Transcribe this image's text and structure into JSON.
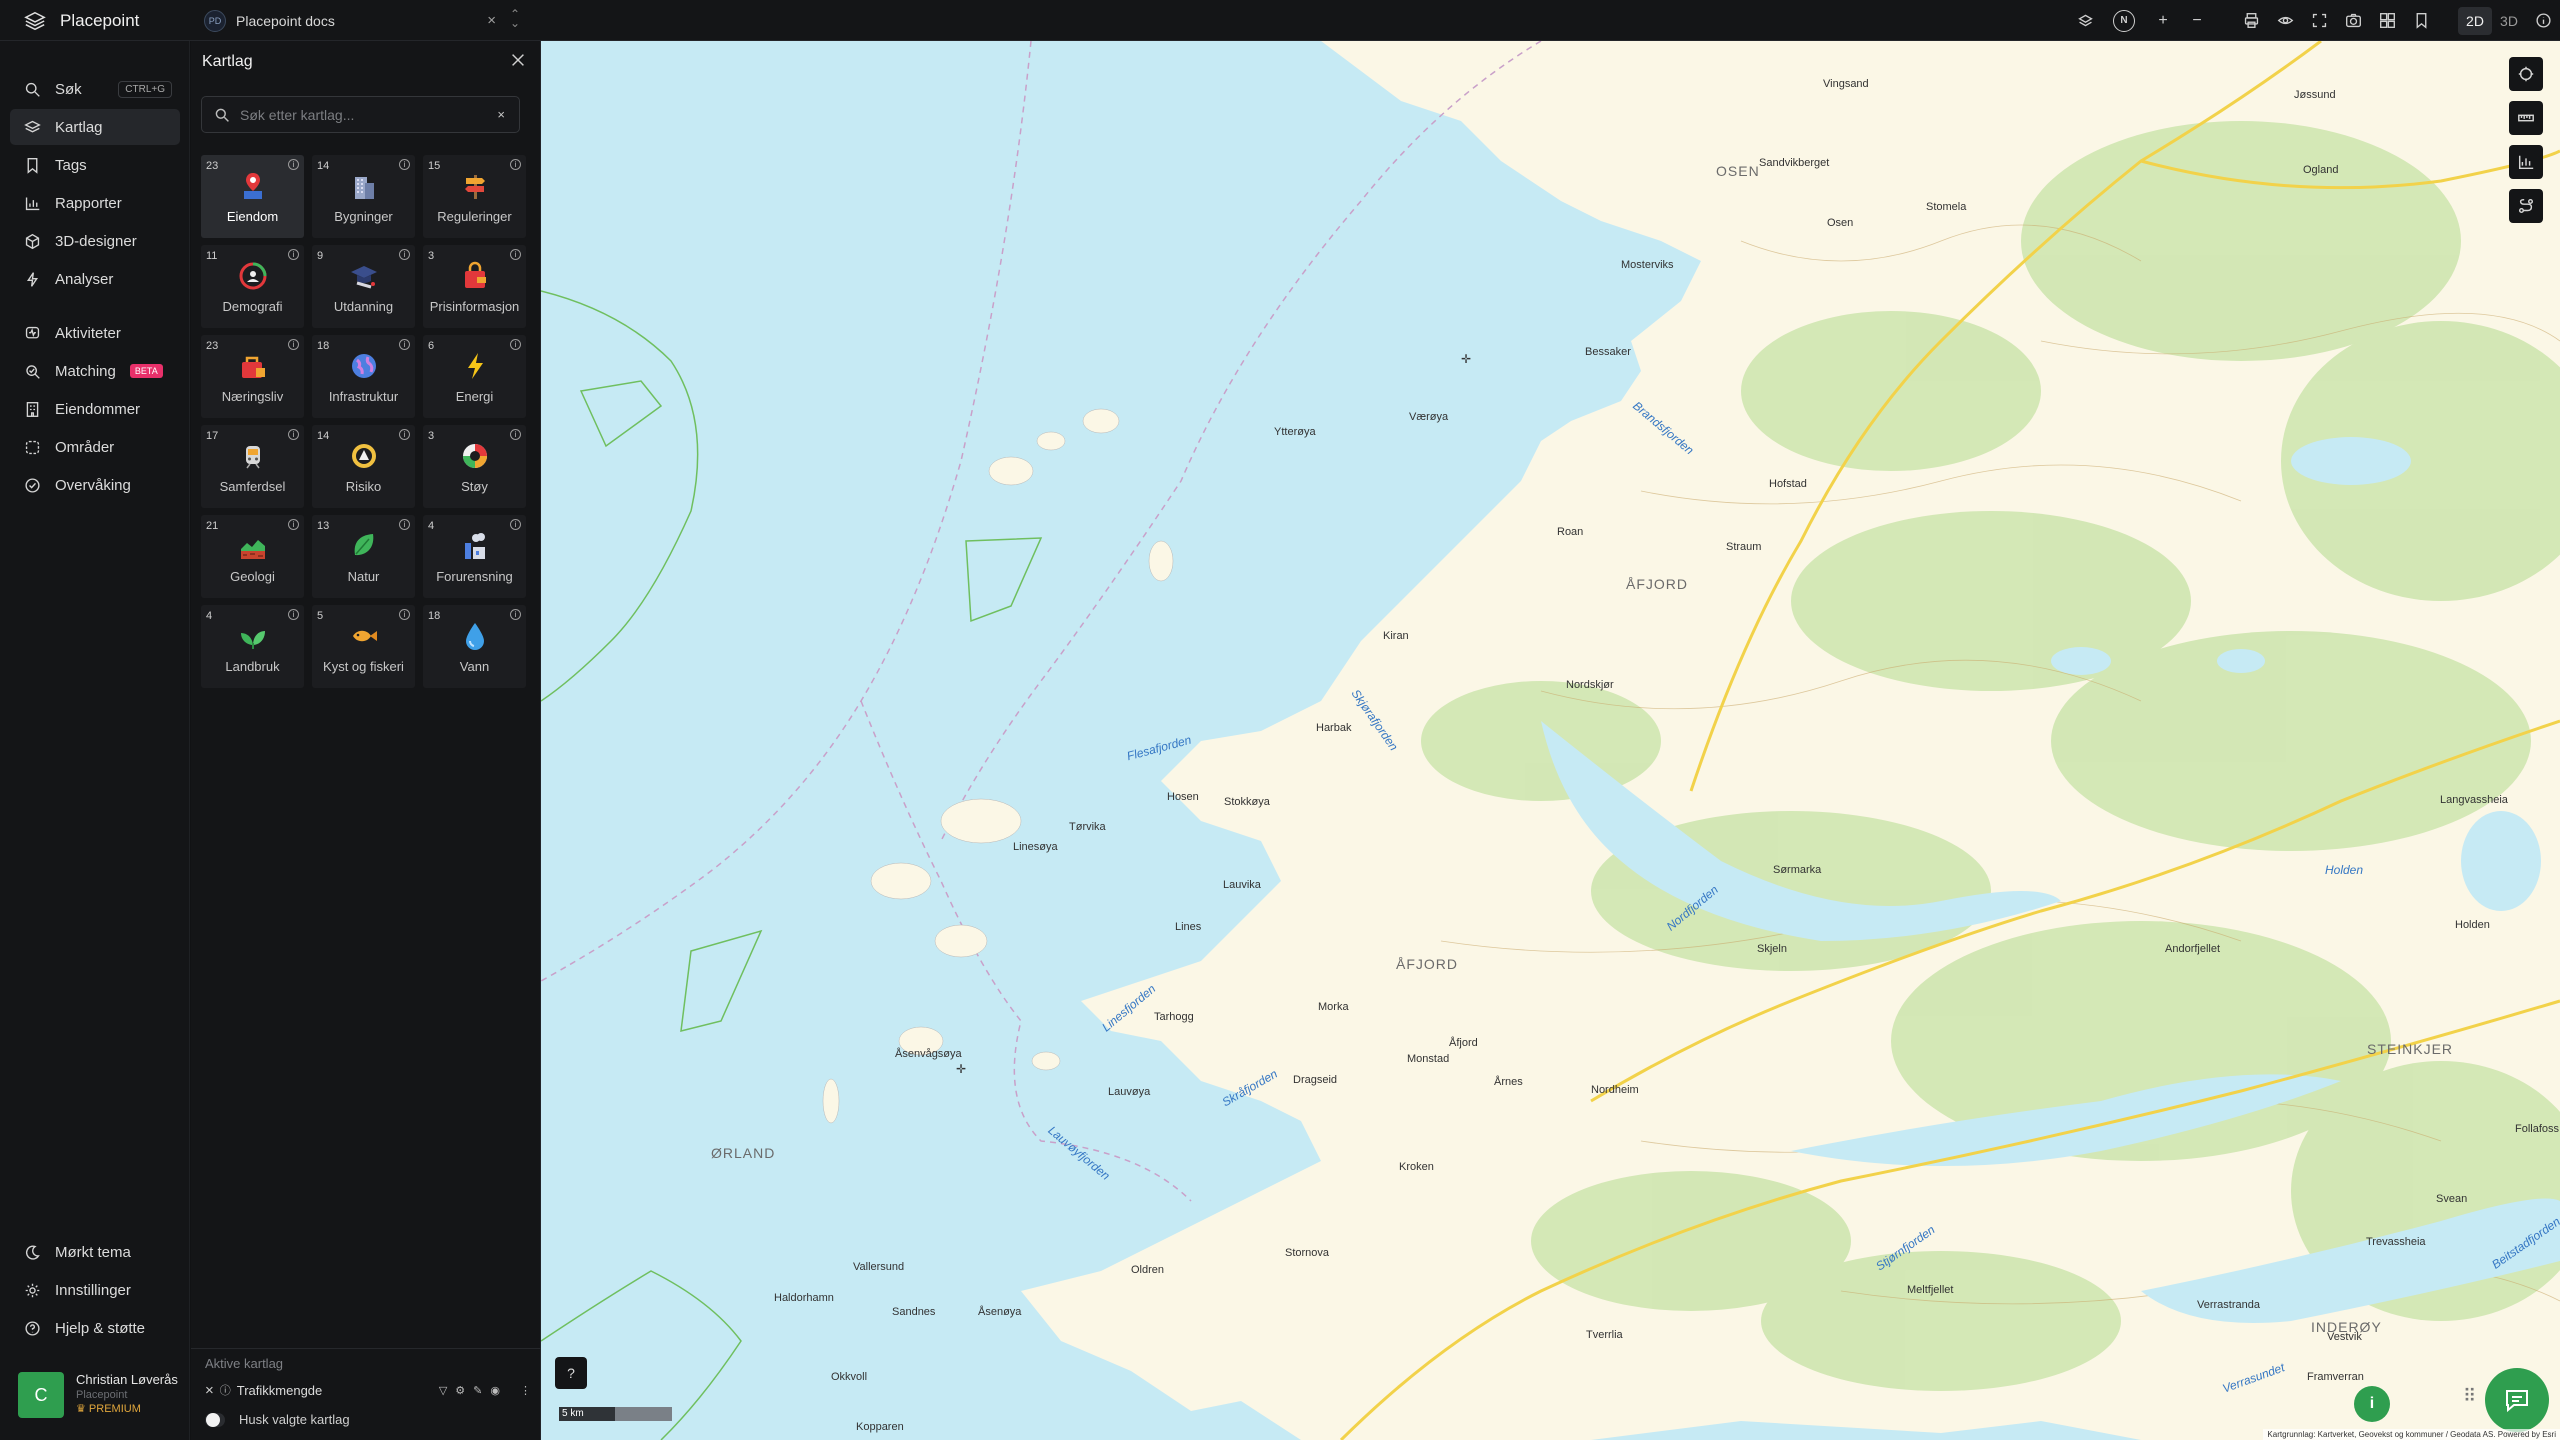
{
  "app": {
    "name": "Placepoint"
  },
  "docs_tab": {
    "badge": "PD",
    "title": "Placepoint docs",
    "close": "×",
    "switch": "⌃⌄"
  },
  "toolbar": {
    "icons": [
      "layers-download-icon",
      "compass-icon",
      "zoom-in-icon",
      "zoom-out-icon",
      "print-icon",
      "eye-icon",
      "fullscreen-icon",
      "camera-icon",
      "grid-icon",
      "bookmark-icon"
    ],
    "compass_label": "N",
    "zoom_in": "+",
    "zoom_out": "−",
    "mode_2d": "2D",
    "mode_3d": "3D",
    "active_mode": "2D"
  },
  "sidebar": {
    "items": [
      {
        "label": "Søk",
        "icon": "search-icon",
        "shortcut": "CTRL+G"
      },
      {
        "label": "Kartlag",
        "icon": "layers-icon",
        "active": true
      },
      {
        "label": "Tags",
        "icon": "bookmark-icon"
      },
      {
        "label": "Rapporter",
        "icon": "bar-chart-icon"
      },
      {
        "label": "3D-designer",
        "icon": "cube-icon"
      },
      {
        "label": "Analyser",
        "icon": "bolt-icon"
      },
      {
        "label": "Aktiviteter",
        "icon": "activity-icon"
      },
      {
        "label": "Matching",
        "icon": "match-icon",
        "badge": "BETA"
      },
      {
        "label": "Eiendommer",
        "icon": "building-icon"
      },
      {
        "label": "Områder",
        "icon": "area-icon"
      },
      {
        "label": "Overvåking",
        "icon": "monitor-icon"
      }
    ],
    "bottom": [
      {
        "label": "Mørkt tema",
        "icon": "moon-icon"
      },
      {
        "label": "Innstillinger",
        "icon": "gear-icon"
      },
      {
        "label": "Hjelp & støtte",
        "icon": "help-icon"
      }
    ],
    "user": {
      "initial": "C",
      "name": "Christian Løverås",
      "org": "Placepoint",
      "plan": "PREMIUM"
    }
  },
  "panel": {
    "title": "Kartlag",
    "search_placeholder": "Søk etter kartlag...",
    "search_clear": "×",
    "layers": [
      {
        "count": "23",
        "label": "Eiendom",
        "icon": "property-pin-icon",
        "selected": true
      },
      {
        "count": "14",
        "label": "Bygninger",
        "icon": "buildings-icon"
      },
      {
        "count": "15",
        "label": "Reguleringer",
        "icon": "signpost-icon"
      },
      {
        "count": "11",
        "label": "Demografi",
        "icon": "demography-gauge-icon"
      },
      {
        "count": "9",
        "label": "Utdanning",
        "icon": "graduation-cap-icon"
      },
      {
        "count": "3",
        "label": "Prisinformasjon",
        "icon": "price-bag-icon"
      },
      {
        "count": "23",
        "label": "Næringsliv",
        "icon": "business-bag-icon"
      },
      {
        "count": "18",
        "label": "Infrastruktur",
        "icon": "globe-icon"
      },
      {
        "count": "6",
        "label": "Energi",
        "icon": "lightning-icon"
      },
      {
        "count": "17",
        "label": "Samferdsel",
        "icon": "train-icon"
      },
      {
        "count": "14",
        "label": "Risiko",
        "icon": "hazard-icon"
      },
      {
        "count": "3",
        "label": "Støy",
        "icon": "noise-gauge-icon"
      },
      {
        "count": "21",
        "label": "Geologi",
        "icon": "geology-icon"
      },
      {
        "count": "13",
        "label": "Natur",
        "icon": "leaf-icon"
      },
      {
        "count": "4",
        "label": "Forurensning",
        "icon": "factory-icon"
      },
      {
        "count": "4",
        "label": "Landbruk",
        "icon": "sprout-icon"
      },
      {
        "count": "5",
        "label": "Kyst og fiskeri",
        "icon": "fish-icon"
      },
      {
        "count": "18",
        "label": "Vann",
        "icon": "water-drop-icon"
      }
    ],
    "active_title": "Aktive kartlag",
    "active_layer": "Trafikkmengde",
    "remember_label": "Husk valgte kartlag"
  },
  "map": {
    "labels_big": [
      "ØRLAND",
      "ÅFJORD",
      "ÅFJORD",
      "OSEN",
      "INDERØY",
      "STEINKJER"
    ],
    "places": [
      "Vingsand",
      "Jøssund",
      "Sandvikberget",
      "Osen",
      "Stomela",
      "Ogland",
      "Mosterviks",
      "Bessaker",
      "Ytterøya",
      "Værøya",
      "Roan",
      "Kiran",
      "Hofstad",
      "Straum",
      "Hosen",
      "Stokkøya",
      "Harbak",
      "Linesøya",
      "Tørvika",
      "Lauvika",
      "Lines",
      "Tarhogg",
      "Åsenvågsøya",
      "Morka",
      "Nordskjør",
      "Dragseid",
      "Lauvøya",
      "Kroken",
      "Monstad",
      "Åfjord",
      "Årnes",
      "Nordheim",
      "Stornova",
      "Oldren",
      "Haldorhamn",
      "Sandnes",
      "Åsenøya",
      "Vallersund",
      "Okkvoll",
      "Kopparen",
      "Meltfjellet",
      "Tverrlia",
      "Verrastranda",
      "Holden",
      "Andorfjellet",
      "Follafoss",
      "Svean",
      "Vestvik",
      "Framverran",
      "Skjeln",
      "Sørmarka",
      "Langvassheia",
      "Trevassheia"
    ],
    "water": [
      "Brandsfjorden",
      "Skjørafjorden",
      "Flesafjorden",
      "Nordfjorden",
      "Linesfjorden",
      "Skråfjorden",
      "Lauvøyfjorden",
      "Stjørnfjorden",
      "Beitstadfjorden",
      "Verrasundet",
      "Holden"
    ],
    "scale": "5 km",
    "attribution": "Kartgrunnlag: Kartverket, Geovekst og kommuner / Geodata AS. Powered by Esri",
    "help": "?",
    "info": "i",
    "right_tools": [
      "layers-settings-icon",
      "measure-icon",
      "elevation-chart-icon",
      "route-icon"
    ]
  }
}
